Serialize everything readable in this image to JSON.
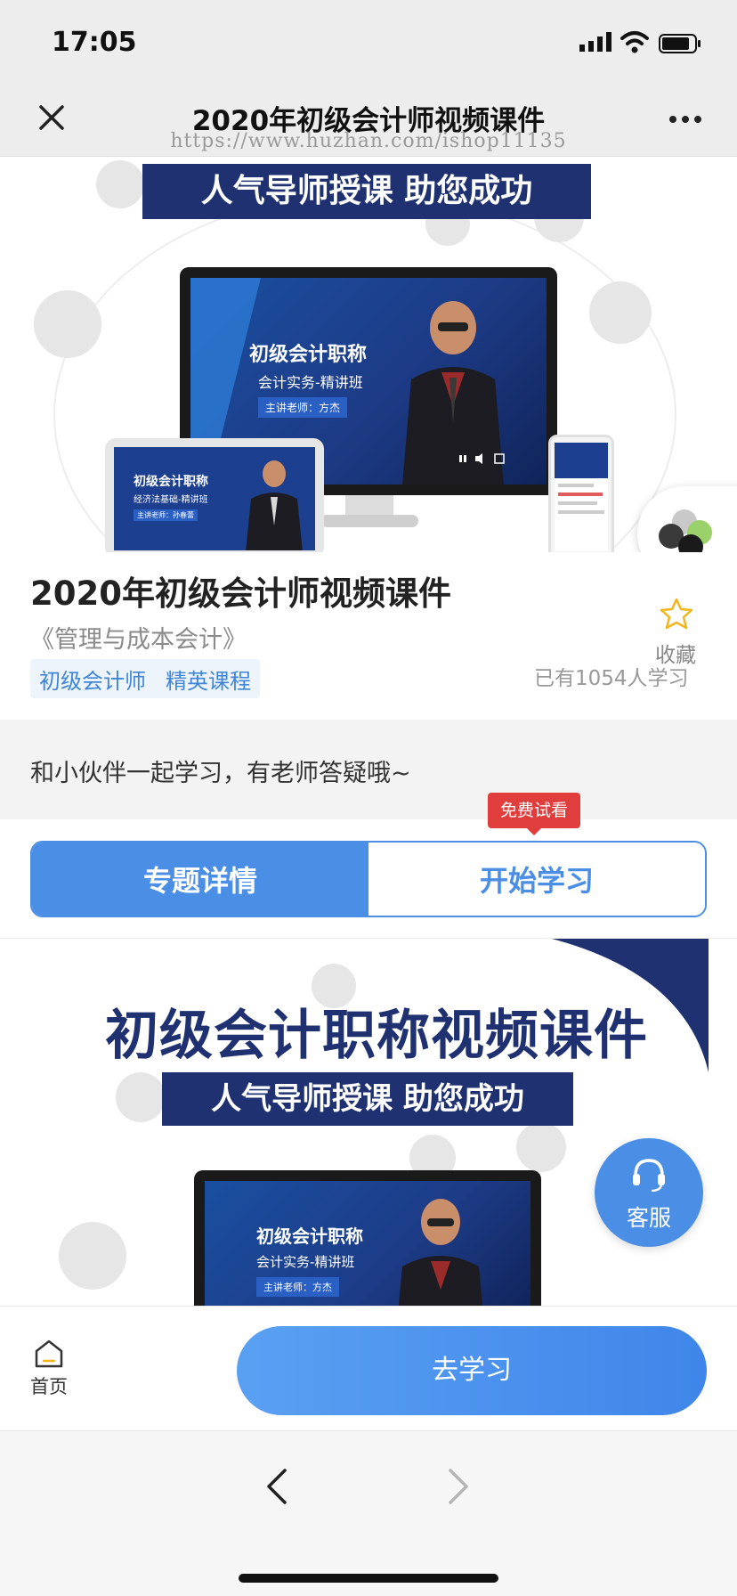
{
  "status_bar": {
    "time": "17:05"
  },
  "nav": {
    "title": "2020年初级会计师视频课件",
    "watermark": "https://www.huzhan.com/ishop11135"
  },
  "banner": {
    "headline": "人气导师授课 助您成功",
    "screen_title": "初级会计职称",
    "screen_subtitle": "会计实务-精讲班",
    "screen_teacher": "主讲老师：方杰",
    "tablet_title": "初级会计职称",
    "tablet_subtitle": "经济法基础-精讲班",
    "tablet_teacher": "主讲老师：孙春蕾"
  },
  "course": {
    "title": "2020年初级会计师视频课件",
    "subtitle": "《管理与成本会计》",
    "tags": [
      "初级会计师",
      "精英课程"
    ],
    "favorite_label": "收藏",
    "learners": "已有1054人学习"
  },
  "group": {
    "text": "和小伙伴一起学习，有老师答疑哦~"
  },
  "tabs": {
    "items": [
      {
        "label": "专题详情",
        "active": true
      },
      {
        "label": "开始学习",
        "active": false
      }
    ],
    "badge": "免费试看"
  },
  "detail": {
    "big_title": "初级会计职称视频课件",
    "strip": "人气导师授课 助您成功",
    "screen_title": "初级会计职称",
    "screen_subtitle": "会计实务-精讲班",
    "screen_teacher": "主讲老师：方杰"
  },
  "customer_service": {
    "label": "客服"
  },
  "action_bar": {
    "home_label": "首页",
    "go_label": "去学习"
  },
  "colors": {
    "accent": "#4a8ee6",
    "navy": "#1f3171",
    "badge_red": "#e03d3d"
  }
}
